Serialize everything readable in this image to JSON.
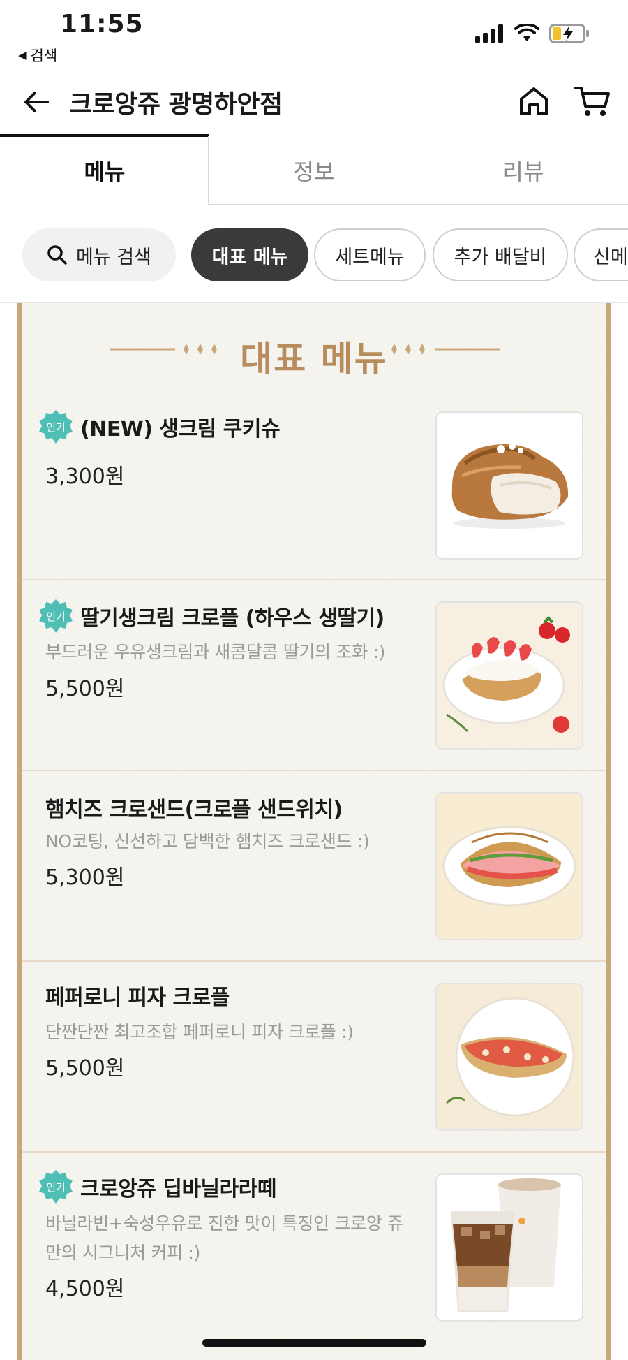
{
  "status_bar": {
    "time": "11:55",
    "back_label": "검색"
  },
  "header": {
    "title": "크로앙쥬 광명하안점"
  },
  "tabs": [
    {
      "label": "메뉴",
      "active": true
    },
    {
      "label": "정보",
      "active": false
    },
    {
      "label": "리뷰",
      "active": false
    }
  ],
  "chips": {
    "search": "메뉴 검색",
    "items": [
      "대표 메뉴",
      "세트메뉴",
      "추가 배달비",
      "신메"
    ]
  },
  "section": {
    "heading": "대표 메뉴"
  },
  "menu_items": [
    {
      "badge": "인기",
      "name": "(NEW) 생크림 쿠키슈",
      "desc": "",
      "price": "3,300원"
    },
    {
      "badge": "인기",
      "name": "딸기생크림 크로플 (하우스 생딸기)",
      "desc": "부드러운 우유생크림과 새콤달콤 딸기의 조화 :)",
      "price": "5,500원"
    },
    {
      "badge": "",
      "name": "햄치즈 크로샌드(크로플 샌드위치)",
      "desc": "NO코팅, 신선하고 담백한 햄치즈 크로샌드 :)",
      "price": "5,300원"
    },
    {
      "badge": "",
      "name": "페퍼로니 피자 크로플",
      "desc": "단짠단짠 최고조합 페퍼로니 피자 크로플 :)",
      "price": "5,500원"
    },
    {
      "badge": "인기",
      "name": "크로앙쥬 딥바닐라라떼",
      "desc": "바닐라빈+숙성우유로 진한 맛이 특징인 크로앙 쥬만의 시그니처 커피 :)",
      "price": "4,500원"
    }
  ],
  "colors": {
    "accent_gold": "#c9a67c",
    "heading_gold": "#b88d5e",
    "badge_teal": "#4fbfb6",
    "chip_active": "#3a3a3a"
  }
}
